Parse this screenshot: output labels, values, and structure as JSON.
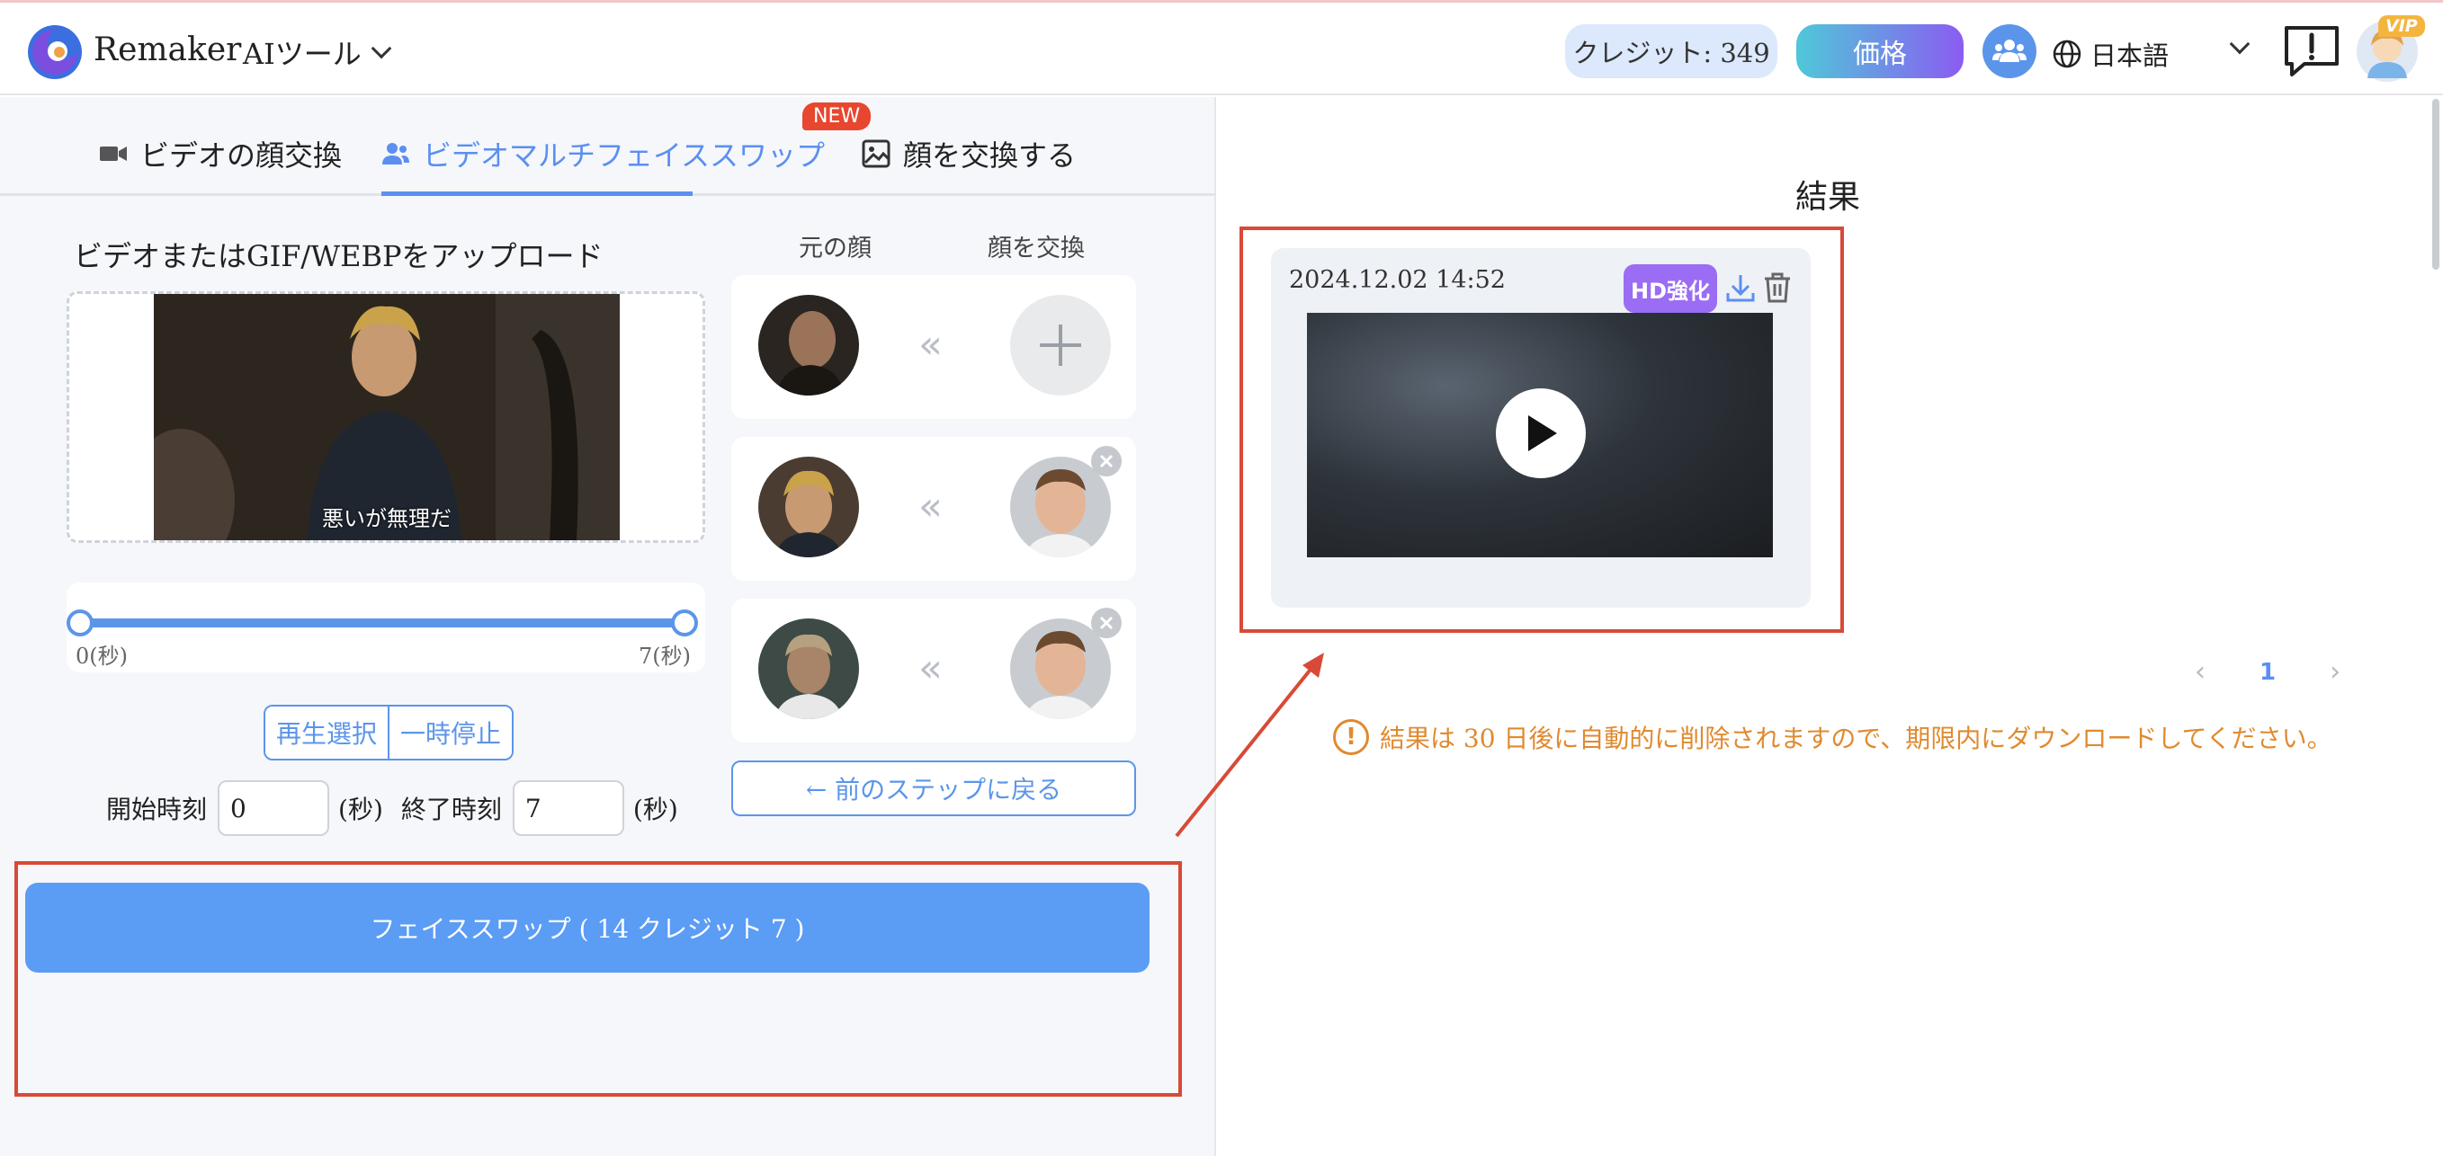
{
  "header": {
    "brand": "Remaker",
    "ai_tools_label": "AIツール",
    "credits_label": "クレジット: 349",
    "price_label": "価格",
    "language": "日本語",
    "vip_label": "VIP"
  },
  "tabs": [
    {
      "label": "ビデオの顔交換",
      "icon": "video-camera-icon"
    },
    {
      "label": "ビデオマルチフェイススワップ",
      "icon": "users-icon",
      "active": true,
      "badge": "NEW"
    },
    {
      "label": "顔を交換する",
      "icon": "image-icon"
    }
  ],
  "upload": {
    "title": "ビデオまたはGIF/WEBPをアップロード",
    "subtitle_text": "悪いが無理だ"
  },
  "range": {
    "start_label": "0(秒)",
    "end_label": "7(秒)"
  },
  "playback": {
    "replay_label": "再生選択",
    "pause_label": "一時停止"
  },
  "time": {
    "start_label": "開始時刻",
    "start_value": "0",
    "end_label": "終了時刻",
    "end_value": "7",
    "unit": "(秒)"
  },
  "faces": {
    "source_header": "元の顔",
    "target_header": "顔を交換",
    "separator": "«",
    "back_label": "← 前のステップに戻る"
  },
  "swap": {
    "button_label": "フェイススワップ ( 14 クレジット 7 )"
  },
  "result": {
    "title": "結果",
    "date": "2024.12.02 14:52",
    "hd_label": "HD強化",
    "page_number": "1",
    "notice": "結果は 30 日後に自動的に削除されますので、期限内にダウンロードしてください。"
  },
  "colors": {
    "accent": "#5b8ff0",
    "swap_button": "#5b9cf5",
    "annotation": "#d84a37",
    "notice": "#e08a2f",
    "hd": "#9a6df4"
  }
}
